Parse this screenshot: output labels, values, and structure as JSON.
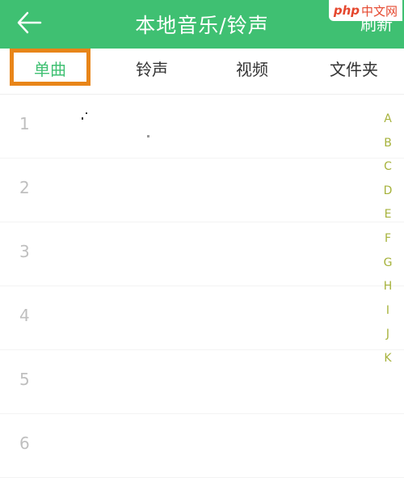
{
  "header": {
    "back_icon": "back-arrow-icon",
    "title": "本地音乐/铃声",
    "refresh_label": "刷新",
    "background": "#3fc072"
  },
  "watermark": {
    "brand": "php",
    "site": "中文网"
  },
  "tabs": [
    {
      "label": "单曲",
      "active": true
    },
    {
      "label": "铃声",
      "active": false
    },
    {
      "label": "视频",
      "active": false
    },
    {
      "label": "文件夹",
      "active": false
    }
  ],
  "accent_color": "#3fc072",
  "highlight_color": "#e88519",
  "index_color": "#a6b23b",
  "rows": [
    "1",
    "2",
    "3",
    "4",
    "5",
    "6"
  ],
  "index_letters": [
    "A",
    "B",
    "C",
    "D",
    "E",
    "F",
    "G",
    "H",
    "I",
    "J",
    "K"
  ]
}
